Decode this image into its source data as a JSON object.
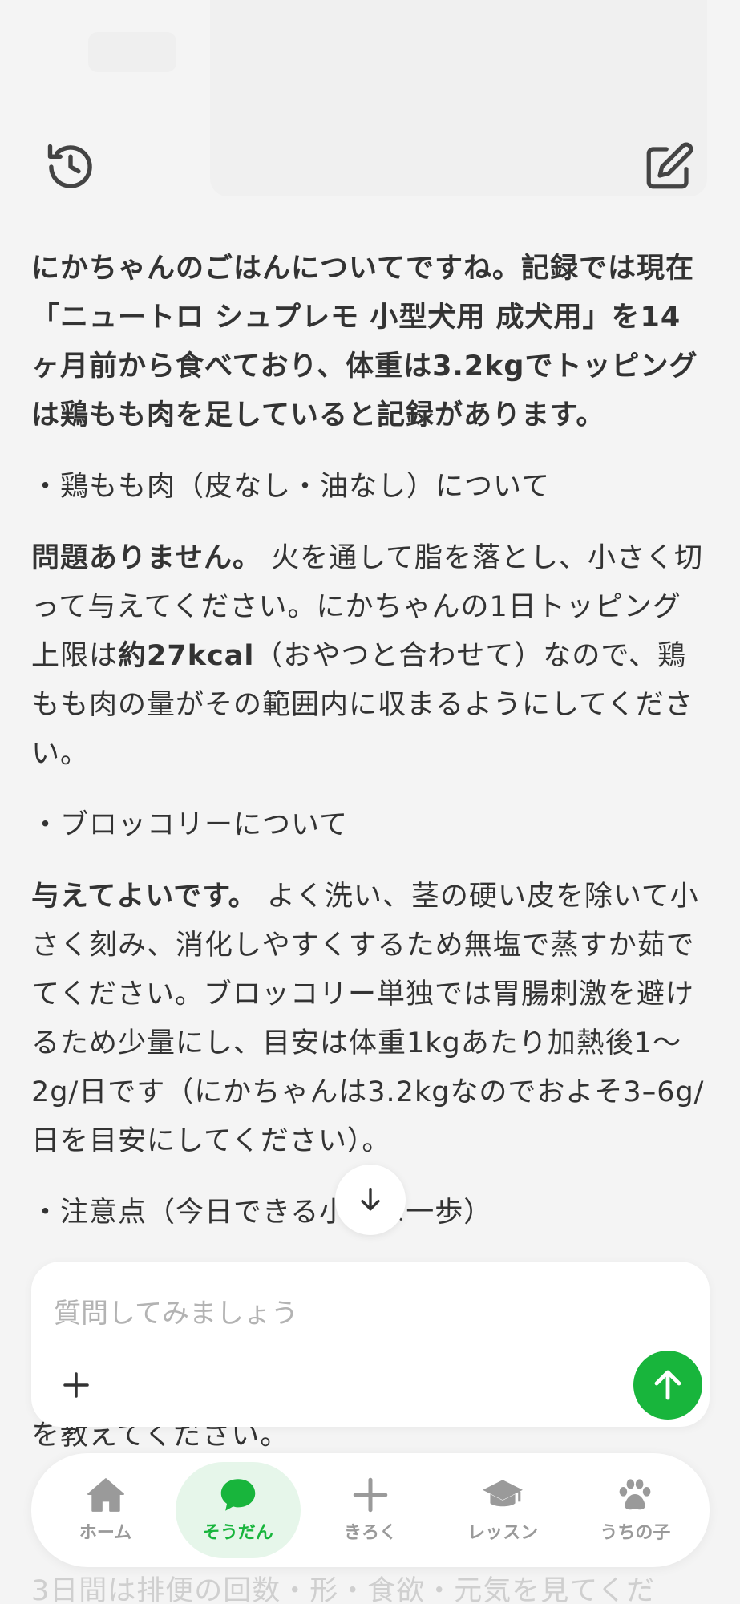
{
  "header": {
    "history_icon": "history-icon",
    "compose_icon": "compose-icon"
  },
  "message": {
    "intro": "にかちゃんのごはんについてですね。記録では現在「ニュートロ シュプレモ 小型犬用 成犬用」を14ヶ月前から食べており、体重は3.2kgでトッピングは鶏もも肉を足していると記録があります。",
    "section1_title": "・鶏もも肉（皮なし・油なし）について",
    "section1_lead": "問題ありません。",
    "section1_body_a": " 火を通して脂を落とし、小さく切って与えてください。にかちゃんの1日トッピング上限は",
    "section1_emph": "約27kcal",
    "section1_body_b": "（おやつと合わせて）なので、鶏もも肉の量がその範囲内に収まるようにしてください。",
    "section2_title": "・ブロッコリーについて",
    "section2_lead": "与えてよいです。",
    "section2_body": " よく洗い、茎の硬い皮を除いて小さく刻み、消化しやすくするため無塩で蒸すか茹でてください。ブロッコリー単独では胃腸刺激を避けるため少量にし、目安は体重1kgあたり加熱後1〜2g/日です（にかちゃんは3.2kgなのでおよそ3–6g/日を目安にしてください）。",
    "section3_title": "・注意点（今日できる小さな一歩）",
    "partial_line": "を教えてください。",
    "bottom_partial": "3日間は排便の回数・形・食欲・元気を見てくだ"
  },
  "composer": {
    "placeholder": "質問してみましょう"
  },
  "tabs": [
    {
      "label": "ホーム",
      "icon": "home-icon",
      "active": false
    },
    {
      "label": "そうだん",
      "icon": "chat-bubble-icon",
      "active": true
    },
    {
      "label": "きろく",
      "icon": "plus-icon",
      "active": false
    },
    {
      "label": "レッスン",
      "icon": "graduation-cap-icon",
      "active": false
    },
    {
      "label": "うちの子",
      "icon": "paw-icon",
      "active": false
    }
  ],
  "colors": {
    "accent": "#18b53c",
    "text": "#333333",
    "background": "#f4f4f4"
  }
}
